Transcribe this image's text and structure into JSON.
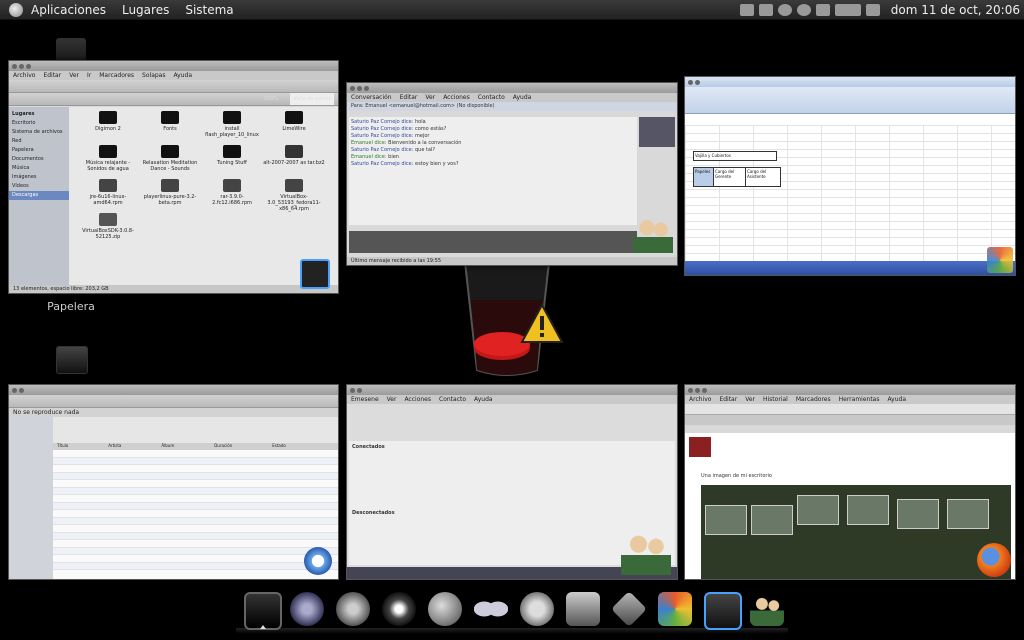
{
  "top_panel": {
    "menus": [
      "Aplicaciones",
      "Lugares",
      "Sistema"
    ],
    "clock": "dom 11 de oct, 20:06",
    "tray_icons": [
      "mail-icon",
      "chat-icon",
      "skype-icon",
      "power-icon",
      "network-icon",
      "update-icon",
      "volume-icon"
    ]
  },
  "desktop": {
    "icons": [
      {
        "label": "Papelera",
        "icon": "trash-icon"
      }
    ]
  },
  "windows": {
    "file_manager": {
      "menu": [
        "Archivo",
        "Editar",
        "Ver",
        "Ir",
        "Marcadores",
        "Solapas",
        "Ayuda"
      ],
      "zoom": "100%",
      "view_mode": "Vista de iconos",
      "sidebar_title": "Lugares",
      "sidebar": [
        "Escritorio",
        "Sistema de archivos",
        "Red",
        "Papelera",
        "Documentos",
        "Música",
        "Imágenes",
        "Vídeos",
        "Descargas"
      ],
      "files": [
        {
          "name": "Digimon 2",
          "type": "folder"
        },
        {
          "name": "Fonts",
          "type": "folder"
        },
        {
          "name": "install flash_player_10_linux",
          "type": "folder"
        },
        {
          "name": "LimeWire",
          "type": "folder"
        },
        {
          "name": "Música relajante - Sonidos de agua",
          "type": "folder"
        },
        {
          "name": "Relaxation Meditation Dance - Sounds",
          "type": "folder"
        },
        {
          "name": "Tuning Stuff",
          "type": "folder"
        },
        {
          "name": "alt-2007-2007 as tar.bz2",
          "type": "archive"
        },
        {
          "name": "jre-6u16-linux-amd64.rpm",
          "type": "package"
        },
        {
          "name": "playerlinux-pure-3.2-beta.rpm",
          "type": "package"
        },
        {
          "name": "rar-3.9.0-2.fc12.i686.rpm",
          "type": "package"
        },
        {
          "name": "VirtualBox-3.0_53193_fedora11-x86_64.rpm",
          "type": "package"
        },
        {
          "name": "VirtualBoxSDK-3.0.8-52125.zip",
          "type": "zip"
        }
      ],
      "status": "13 elementos, espacio libre: 203,2 GB"
    },
    "chat": {
      "menu": [
        "Conversación",
        "Editar",
        "Ver",
        "Acciones",
        "Contacto",
        "Ayuda"
      ],
      "header": "Para: Emanuel <emanuel@hotmail.com> (No disponible)",
      "lines": [
        {
          "who": "Saturio Paz Cornejo dice:",
          "text": "hola",
          "color": "b"
        },
        {
          "who": "Saturio Paz Cornejo dice:",
          "text": "como estás?",
          "color": "b"
        },
        {
          "who": "Saturio Paz Cornejo dice:",
          "text": "mejor",
          "color": "b"
        },
        {
          "who": "Emanuel dice:",
          "text": "Bienvenido a la conversación",
          "color": "g"
        },
        {
          "who": "Saturio Paz Cornejo dice:",
          "text": "que tal?",
          "color": "b"
        },
        {
          "who": "Emanuel dice:",
          "text": "bien",
          "color": "g"
        },
        {
          "who": "Saturio Paz Cornejo dice:",
          "text": "estoy bien y vos?",
          "color": "b"
        }
      ],
      "status": "Último mensaje recibido a las 19:55"
    },
    "spreadsheet": {
      "cells": [
        "Vajilla y Cubiertos",
        "Papeles",
        "Cargo del Gerente",
        "Cargo del Asistente"
      ]
    },
    "music": {
      "header": "No se reproduce nada",
      "columns": [
        "Título",
        "Artista",
        "Álbum",
        "Duración",
        "Estado"
      ]
    },
    "messenger_list": {
      "menu": [
        "Emesene",
        "Ver",
        "Acciones",
        "Contacto",
        "Ayuda"
      ],
      "groups": [
        "Conectados",
        "Desconectados"
      ]
    },
    "browser": {
      "menu": [
        "Archivo",
        "Editar",
        "Ver",
        "Historial",
        "Marcadores",
        "Herramientas",
        "Ayuda"
      ],
      "page_note": "Una imagen de mi escritorio"
    }
  },
  "dock": {
    "items": [
      {
        "name": "desktop",
        "icon": "monitor-icon",
        "active": true
      },
      {
        "name": "itunes",
        "icon": "music-note-icon",
        "active": false
      },
      {
        "name": "settings",
        "icon": "gear-icon",
        "active": false
      },
      {
        "name": "media-player",
        "icon": "disc-icon",
        "active": false
      },
      {
        "name": "browser",
        "icon": "globe-icon",
        "active": false
      },
      {
        "name": "messenger",
        "icon": "butterfly-icon",
        "active": false
      },
      {
        "name": "chat",
        "icon": "chat-bubble-icon",
        "active": false
      },
      {
        "name": "scanner",
        "icon": "scanner-icon",
        "active": false
      },
      {
        "name": "virtualbox",
        "icon": "cube-icon",
        "active": false
      },
      {
        "name": "office",
        "icon": "office-icon",
        "active": false
      },
      {
        "name": "drive",
        "icon": "drive-icon",
        "active": false
      },
      {
        "name": "users",
        "icon": "users-icon",
        "active": false
      }
    ]
  }
}
